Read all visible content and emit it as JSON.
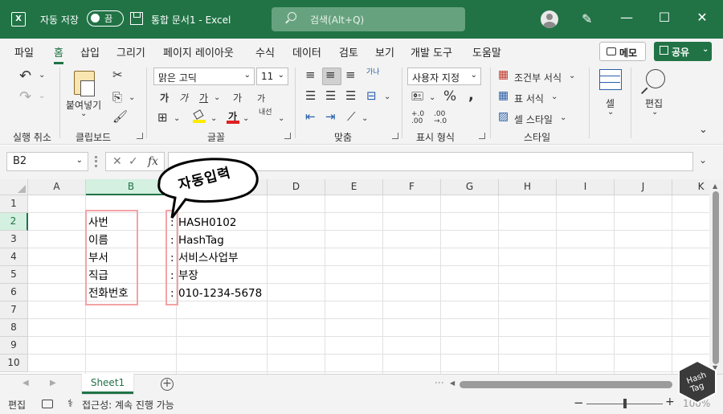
{
  "titlebar": {
    "autosave_label": "자동 저장",
    "autosave_state": "끔",
    "doc_title": "통합 문서1  -  Excel",
    "search_placeholder": "검색(Alt+Q)",
    "minimize": "—",
    "maximize": "☐",
    "close": "✕"
  },
  "menu": {
    "tabs": [
      "파일",
      "홈",
      "삽입",
      "그리기",
      "페이지 레이아웃",
      "수식",
      "데이터",
      "검토",
      "보기",
      "개발 도구",
      "도움말"
    ],
    "active": "홈",
    "memo": "메모",
    "share": "공유"
  },
  "ribbon": {
    "groups": {
      "undo": "실행 취소",
      "clipboard": "클립보드",
      "font": "글꼴",
      "alignment": "맞춤",
      "number": "표시 형식",
      "styles": "스타일",
      "cells": "셀",
      "editing": "편집"
    },
    "paste_label": "붙여넣기",
    "font_name": "맑은 고딕",
    "font_size": "11",
    "number_format": "사용자 지정",
    "conditional_format": "조건부 서식",
    "table_format": "표 서식",
    "cell_styles": "셀 스타일",
    "cell_label": "셀",
    "edit_label": "편집",
    "font_buttons": [
      "가",
      "가",
      "가",
      "가",
      "가"
    ],
    "ruby_label": "내선",
    "wrap_label": "가나"
  },
  "formula_bar": {
    "name_box": "B2",
    "fx": "fx",
    "value": ""
  },
  "sheet": {
    "columns": [
      "A",
      "B",
      "C",
      "D",
      "E",
      "F",
      "G",
      "H",
      "I",
      "J",
      "K"
    ],
    "rows": [
      "1",
      "2",
      "3",
      "4",
      "5",
      "6",
      "7",
      "8",
      "9",
      "10"
    ],
    "labels": [
      "사번",
      "이름",
      "부서",
      "직급",
      "전화번호"
    ],
    "colons": [
      ":",
      ":",
      ":",
      ":",
      ":"
    ],
    "values": [
      "HASH0102",
      "HashTag",
      "서비스사업부",
      "부장",
      "010-1234-5678"
    ],
    "selected_column": "B",
    "selected_row": "2",
    "highlight_color": "#f4a3a6"
  },
  "annotation": {
    "text": "자동입력"
  },
  "sheet_tabs": {
    "active": "Sheet1",
    "add": "+"
  },
  "status": {
    "mode": "편집",
    "accessibility": "접근성: 계속 진행 가능",
    "zoom": "100%"
  },
  "watermark": {
    "text": "Hash Tag"
  },
  "colors": {
    "accent": "#217346",
    "ribbon_bg": "#f3f3f3"
  }
}
